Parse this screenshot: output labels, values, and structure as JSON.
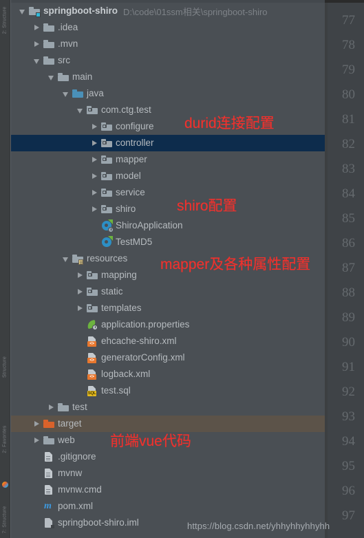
{
  "app": {
    "theme_bg": "#4a4f54",
    "selection_color": "#0d2c4c",
    "hover_color": "#5c5349",
    "annotation_color": "#f0312d",
    "text_color": "#b6bbbf"
  },
  "toolstrip": {
    "labels": [
      "2: Structure",
      "Structure",
      "2: Favorites",
      "7: Structure"
    ],
    "indicator": "color-indicator-icon"
  },
  "project_tree": {
    "root": {
      "label": "springboot-shiro",
      "path": "D:\\code\\01ssm相关\\springboot-shiro",
      "icon": "module-folder-icon",
      "expanded": true
    },
    "rows": [
      {
        "label": "springboot-shiro",
        "path": "D:\\code\\01ssm相关\\springboot-shiro",
        "icon": "module-folder-icon",
        "depth": 0,
        "arrow": "down",
        "bold": true,
        "state": "normal"
      },
      {
        "label": ".idea",
        "path": "",
        "icon": "folder-icon",
        "depth": 1,
        "arrow": "right",
        "bold": false,
        "state": "normal"
      },
      {
        "label": ".mvn",
        "path": "",
        "icon": "folder-icon",
        "depth": 1,
        "arrow": "right",
        "bold": false,
        "state": "normal"
      },
      {
        "label": "src",
        "path": "",
        "icon": "folder-icon",
        "depth": 1,
        "arrow": "down",
        "bold": false,
        "state": "normal"
      },
      {
        "label": "main",
        "path": "",
        "icon": "folder-icon",
        "depth": 2,
        "arrow": "down",
        "bold": false,
        "state": "normal"
      },
      {
        "label": "java",
        "path": "",
        "icon": "source-folder-icon",
        "depth": 3,
        "arrow": "down",
        "bold": false,
        "state": "normal"
      },
      {
        "label": "com.ctg.test",
        "path": "",
        "icon": "package-icon",
        "depth": 4,
        "arrow": "down",
        "bold": false,
        "state": "normal"
      },
      {
        "label": "configure",
        "path": "",
        "icon": "package-icon",
        "depth": 5,
        "arrow": "right",
        "bold": false,
        "state": "normal"
      },
      {
        "label": "controller",
        "path": "",
        "icon": "package-icon",
        "depth": 5,
        "arrow": "right",
        "bold": false,
        "state": "selected"
      },
      {
        "label": "mapper",
        "path": "",
        "icon": "package-icon",
        "depth": 5,
        "arrow": "right",
        "bold": false,
        "state": "normal"
      },
      {
        "label": "model",
        "path": "",
        "icon": "package-icon",
        "depth": 5,
        "arrow": "right",
        "bold": false,
        "state": "normal"
      },
      {
        "label": "service",
        "path": "",
        "icon": "package-icon",
        "depth": 5,
        "arrow": "right",
        "bold": false,
        "state": "normal"
      },
      {
        "label": "shiro",
        "path": "",
        "icon": "package-icon",
        "depth": 5,
        "arrow": "right",
        "bold": false,
        "state": "normal"
      },
      {
        "label": "ShiroApplication",
        "path": "",
        "icon": "spring-boot-class-icon",
        "depth": 5,
        "arrow": "none",
        "bold": false,
        "state": "normal"
      },
      {
        "label": "TestMD5",
        "path": "",
        "icon": "java-class-icon",
        "depth": 5,
        "arrow": "none",
        "bold": false,
        "state": "normal"
      },
      {
        "label": "resources",
        "path": "",
        "icon": "resources-folder-icon",
        "depth": 3,
        "arrow": "down",
        "bold": false,
        "state": "normal"
      },
      {
        "label": "mapping",
        "path": "",
        "icon": "package-icon",
        "depth": 4,
        "arrow": "right",
        "bold": false,
        "state": "normal"
      },
      {
        "label": "static",
        "path": "",
        "icon": "package-icon",
        "depth": 4,
        "arrow": "right",
        "bold": false,
        "state": "normal"
      },
      {
        "label": "templates",
        "path": "",
        "icon": "package-icon",
        "depth": 4,
        "arrow": "right",
        "bold": false,
        "state": "normal"
      },
      {
        "label": "application.properties",
        "path": "",
        "icon": "spring-properties-icon",
        "depth": 4,
        "arrow": "none",
        "bold": false,
        "state": "normal"
      },
      {
        "label": "ehcache-shiro.xml",
        "path": "",
        "icon": "xml-file-icon",
        "depth": 4,
        "arrow": "none",
        "bold": false,
        "state": "normal"
      },
      {
        "label": "generatorConfig.xml",
        "path": "",
        "icon": "xml-file-icon",
        "depth": 4,
        "arrow": "none",
        "bold": false,
        "state": "normal"
      },
      {
        "label": "logback.xml",
        "path": "",
        "icon": "xml-file-icon",
        "depth": 4,
        "arrow": "none",
        "bold": false,
        "state": "normal"
      },
      {
        "label": "test.sql",
        "path": "",
        "icon": "sql-file-icon",
        "depth": 4,
        "arrow": "none",
        "bold": false,
        "state": "normal"
      },
      {
        "label": "test",
        "path": "",
        "icon": "folder-icon",
        "depth": 2,
        "arrow": "right",
        "bold": false,
        "state": "normal"
      },
      {
        "label": "target",
        "path": "",
        "icon": "excluded-folder-icon",
        "depth": 1,
        "arrow": "right",
        "bold": false,
        "state": "hovered"
      },
      {
        "label": "web",
        "path": "",
        "icon": "folder-icon",
        "depth": 1,
        "arrow": "right",
        "bold": false,
        "state": "normal"
      },
      {
        "label": ".gitignore",
        "path": "",
        "icon": "text-file-icon",
        "depth": 1,
        "arrow": "none",
        "bold": false,
        "state": "normal"
      },
      {
        "label": "mvnw",
        "path": "",
        "icon": "text-file-icon",
        "depth": 1,
        "arrow": "none",
        "bold": false,
        "state": "normal"
      },
      {
        "label": "mvnw.cmd",
        "path": "",
        "icon": "text-file-icon",
        "depth": 1,
        "arrow": "none",
        "bold": false,
        "state": "normal"
      },
      {
        "label": "pom.xml",
        "path": "",
        "icon": "maven-file-icon",
        "depth": 1,
        "arrow": "none",
        "bold": false,
        "state": "normal"
      },
      {
        "label": "springboot-shiro.iml",
        "path": "",
        "icon": "module-file-icon",
        "depth": 1,
        "arrow": "none",
        "bold": false,
        "state": "normal"
      }
    ]
  },
  "annotations": [
    {
      "text": "durid连接配置",
      "target": "configure"
    },
    {
      "text": "shiro配置",
      "target": "shiro"
    },
    {
      "text": "mapper及各种属性配置",
      "target": "resources"
    },
    {
      "text": "前端vue代码",
      "target": "web"
    }
  ],
  "editor_gutter": {
    "line_numbers": [
      77,
      78,
      79,
      80,
      81,
      82,
      83,
      84,
      85,
      86,
      87,
      88,
      89,
      90,
      91,
      92,
      93,
      94,
      95,
      96,
      97
    ]
  },
  "watermark": {
    "text": "https://blog.csdn.net/yhhyhhyhhyhh"
  }
}
